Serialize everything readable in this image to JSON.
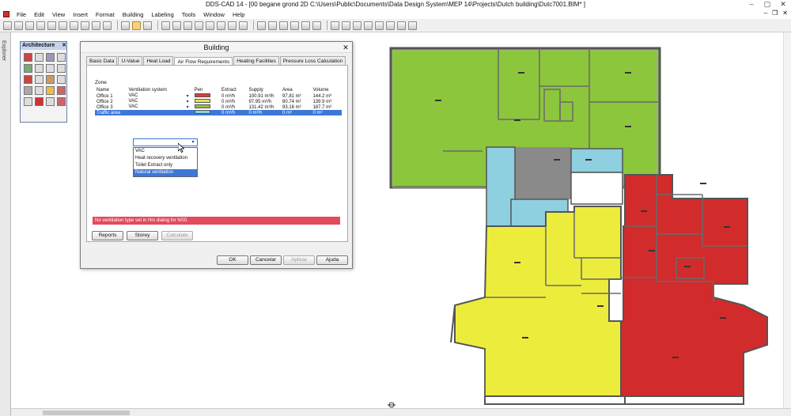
{
  "window": {
    "title": "DDS-CAD 14 - [00 begane grond  2D  C:\\Users\\Public\\Documents\\Data Design System\\MEP 14\\Projects\\Dutch building\\Dutc7001.BIM* ]"
  },
  "menu": [
    "File",
    "Edit",
    "View",
    "Insert",
    "Format",
    "Building",
    "Labeling",
    "Tools",
    "Window",
    "Help"
  ],
  "explorer": {
    "label": "Explorer"
  },
  "palette": {
    "title": "Architecture"
  },
  "dialog": {
    "title": "Building",
    "tabs": [
      "Basic Data",
      "U-Value",
      "Heat Load",
      "Air Flow Requirements",
      "Heating Facilities",
      "Pressure Loss Calculation"
    ],
    "active_tab": 3,
    "zone_label": "Zone",
    "columns": [
      "Name",
      "Ventilation system",
      "Pen",
      "Extract",
      "Supply",
      "Area",
      "Volume"
    ],
    "rows": [
      {
        "name": "Office 1",
        "system": "VAC",
        "pen": "#d93c3c",
        "extract": "0 m³/h",
        "supply": "100.91 m³/h",
        "area": "97.81 m²",
        "volume": "144.2 m³"
      },
      {
        "name": "Office 2",
        "system": "VAC",
        "pen": "#e6e64a",
        "extract": "0 m³/h",
        "supply": "97.95 m³/h",
        "area": "80.74 m²",
        "volume": "139.9 m³"
      },
      {
        "name": "Office 3",
        "system": "VAC",
        "pen": "#8cc63c",
        "extract": "0 m³/h",
        "supply": "131.42 m³/h",
        "area": "93.16 m²",
        "volume": "187.7 m³"
      },
      {
        "name": "Traffic area",
        "system": "",
        "pen": "#8ecfe0",
        "extract": "0 m³/h",
        "supply": "0 m³/h",
        "area": "0 m²",
        "volume": "0 m³"
      }
    ],
    "dropdown_options": [
      "VAC",
      "Heat recovery ventilation",
      "Toilet Extract only",
      "Natural ventilation"
    ],
    "dropdown_highlight": 3,
    "warning": "No ventilation type set in Hrc dialog for NS0.",
    "buttons": {
      "reports": "Reports",
      "storey": "Storey",
      "calculate": "Calculate",
      "ok": "OK",
      "cancel": "Cancelar",
      "apply": "Aplicar",
      "help": "Ajuda"
    }
  },
  "colors": {
    "green_zone": "#8cc63c",
    "blue_zone": "#8ecfe0",
    "yellow_zone": "#ecec3c",
    "red_zone": "#d12b2b",
    "wall": "#6a6a6a"
  }
}
